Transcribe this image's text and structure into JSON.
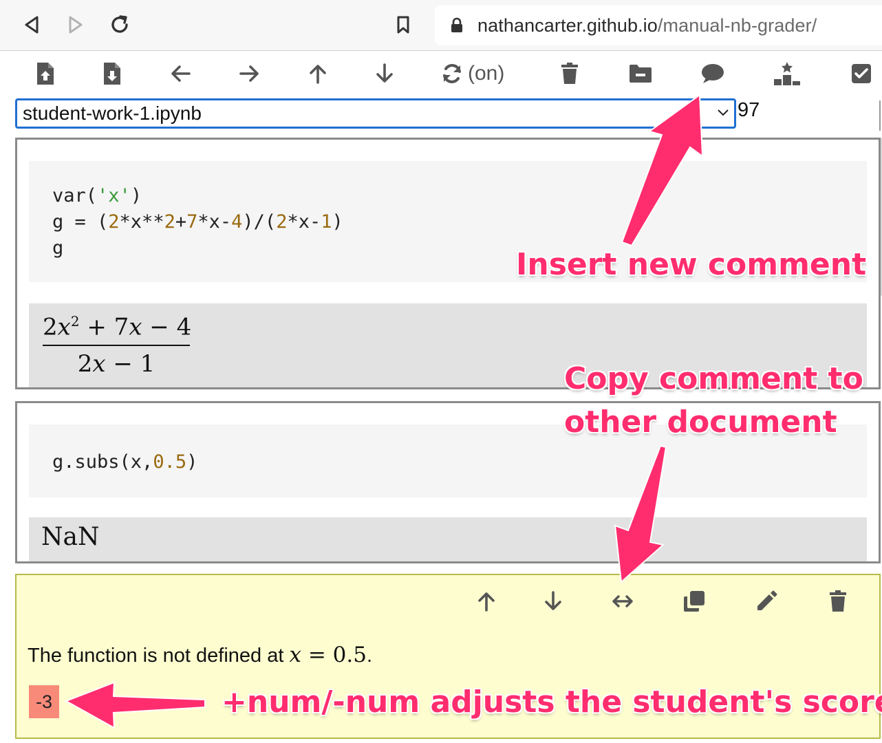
{
  "browser": {
    "url_host": "nathancarter.github.io",
    "url_path": "/manual-nb-grader/"
  },
  "toolbar": {
    "auto_label": "(on)",
    "icons": [
      "upload-file-icon",
      "download-file-icon",
      "arrow-left-icon",
      "arrow-right-icon",
      "arrow-up-icon",
      "arrow-down-icon",
      "sync-icon",
      "trash-icon",
      "folder-minus-icon",
      "comment-icon",
      "podium-icon",
      "checkbox-icon"
    ]
  },
  "file_selector": {
    "selected": "student-work-1.ipynb",
    "count": "97"
  },
  "cells": [
    {
      "code_lines": [
        "var('x')",
        "g = (2*x**2+7*x-4)/(2*x-1)",
        "g"
      ],
      "output": {
        "numerator": "2x² + 7x − 4",
        "denominator": "2x − 1"
      }
    },
    {
      "code_lines": [
        "g.subs(x,0.5)"
      ],
      "output": {
        "text": "NaN"
      }
    }
  ],
  "comment": {
    "text_prefix": "The function is not defined at ",
    "math": "x = 0.5",
    "text_suffix": ".",
    "score": "-3",
    "actions": [
      "move-up",
      "move-down",
      "copy-to-other-document",
      "duplicate",
      "edit",
      "delete"
    ]
  },
  "annotations": {
    "insert": "Insert new comment",
    "copy_line1": "Copy comment to",
    "copy_line2": "other document",
    "score": "+num/-num adjusts the student's score"
  },
  "colors": {
    "annotation": "#ff2d6e",
    "select_border": "#1f6fd1",
    "comment_bg": "#fdfdd0",
    "score_badge": "#f88a7a"
  }
}
